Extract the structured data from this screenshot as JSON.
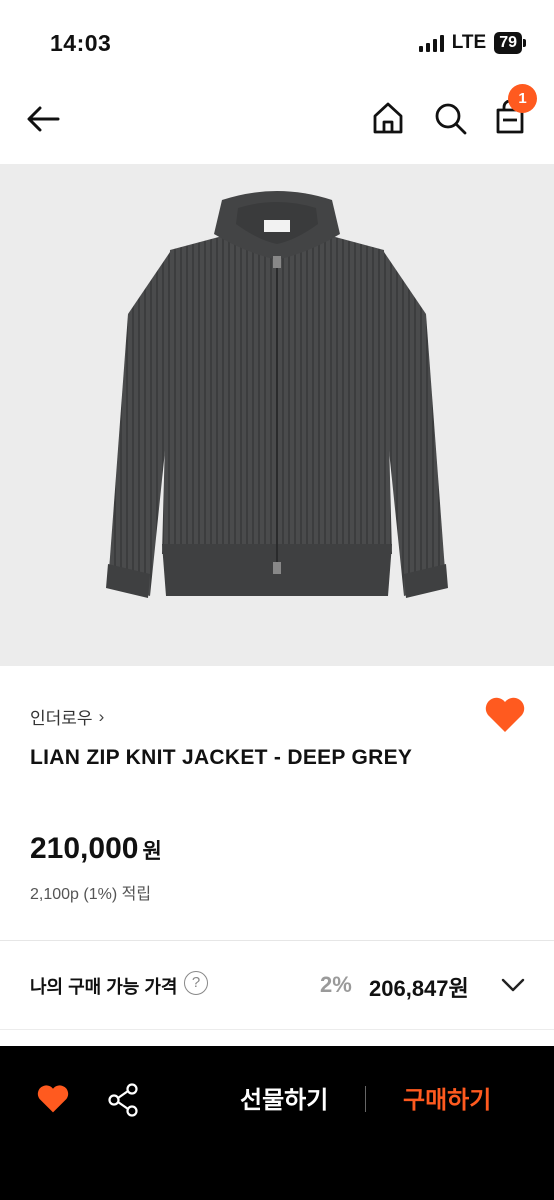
{
  "status_bar": {
    "time": "14:03",
    "network": "LTE",
    "battery": "79"
  },
  "header": {
    "cart_count": "1"
  },
  "product": {
    "brand": "인더로우",
    "name": "LIAN ZIP KNIT JACKET - DEEP GREY",
    "price": "210,000",
    "price_unit": "원",
    "points": "2,100p (1%) 적립"
  },
  "my_price": {
    "label": "나의 구매 가능 가격",
    "help": "?",
    "discount": "2%",
    "price": "206,847원"
  },
  "bottom_bar": {
    "gift_label": "선물하기",
    "buy_label": "구매하기"
  },
  "colors": {
    "accent": "#ff5a1f",
    "knit": "#4a4b4c",
    "image_bg": "#ececec"
  }
}
